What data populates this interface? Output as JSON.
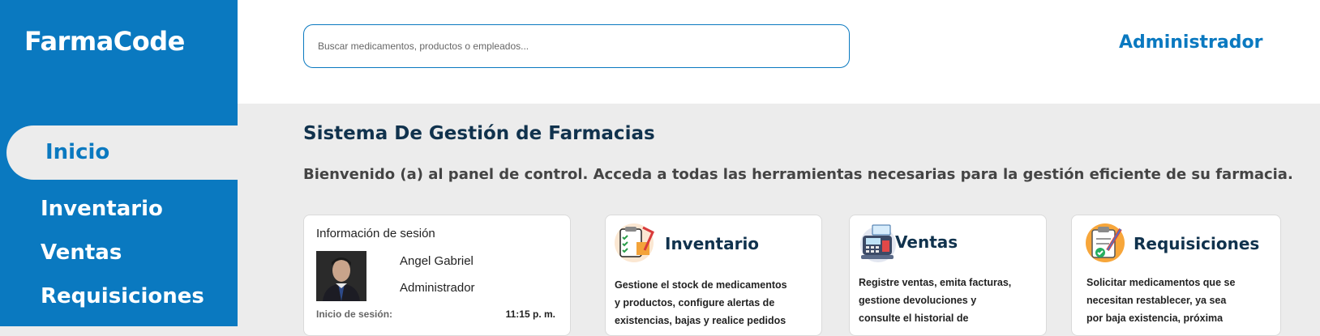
{
  "app": {
    "brand": "FarmaCode"
  },
  "sidebar": {
    "items": [
      {
        "label": "Inicio",
        "active": true
      },
      {
        "label": "Inventario"
      },
      {
        "label": "Ventas"
      },
      {
        "label": "Requisiciones"
      }
    ]
  },
  "header": {
    "search_placeholder": "Buscar medicamentos, productos o empleados...",
    "user_role": "Administrador"
  },
  "main": {
    "title": "Sistema De Gestión de Farmacias",
    "subtitle": "Bienvenido (a) al panel de control. Acceda a todas las herramientas necesarias para la gestión eficiente de su farmacia."
  },
  "session": {
    "title": "Información de sesión",
    "name": "Angel Gabriel",
    "role": "Administrador",
    "start_label": "Inicio de sesión:",
    "start_time": "11:15 p. m."
  },
  "cards": [
    {
      "title": "Inventario",
      "description": "Gestione el stock de medicamentos\ny productos, configure alertas de\nexistencias, bajas y realice pedidos",
      "icon": "inventory-clipboard-icon"
    },
    {
      "title": "Ventas",
      "description": "Registre ventas, emita facturas,\ngestione devoluciones y\nconsulte el historial de",
      "icon": "cash-register-icon"
    },
    {
      "title": "Requisiciones",
      "description": "Solicitar medicamentos que se\nnecesitan restablecer, ya sea\npor baja existencia, próxima",
      "icon": "requisition-clipboard-icon"
    }
  ],
  "colors": {
    "primary": "#0a79c0",
    "heading": "#10324d",
    "background": "#ececec"
  }
}
